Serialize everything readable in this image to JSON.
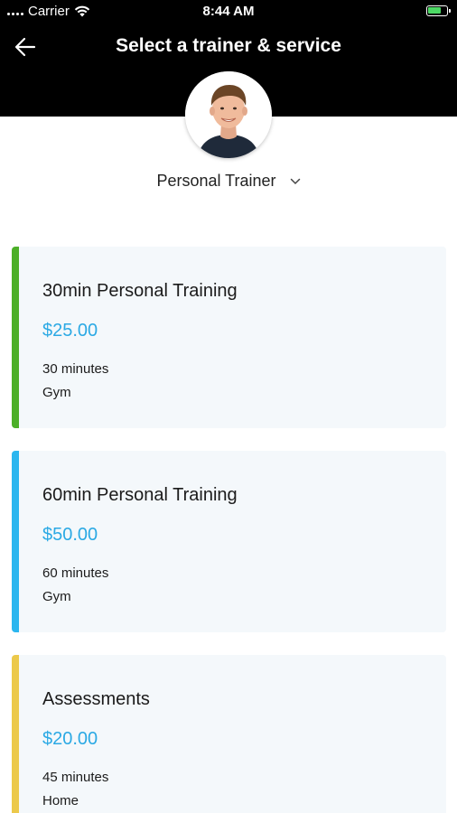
{
  "status_bar": {
    "carrier": "Carrier",
    "time": "8:44 AM",
    "battery_level_percent": 80
  },
  "header": {
    "title": "Select a trainer & service",
    "back_icon": "arrow-left-icon",
    "background_color": "#000000"
  },
  "trainer": {
    "selected": "Personal Trainer",
    "dropdown_icon": "chevron-down-icon"
  },
  "services": [
    {
      "name": "30min Personal Training",
      "price": "$25.00",
      "duration": "30 minutes",
      "location": "Gym",
      "accent_color": "#4caf28"
    },
    {
      "name": "60min Personal Training",
      "price": "$50.00",
      "duration": "60 minutes",
      "location": "Gym",
      "accent_color": "#2bb6ef"
    },
    {
      "name": "Assessments",
      "price": "$20.00",
      "duration": "45 minutes",
      "location": "Home",
      "accent_color": "#ecc94b"
    }
  ],
  "colors": {
    "price": "#2ba9e4",
    "card_background": "#f4f8fb"
  }
}
